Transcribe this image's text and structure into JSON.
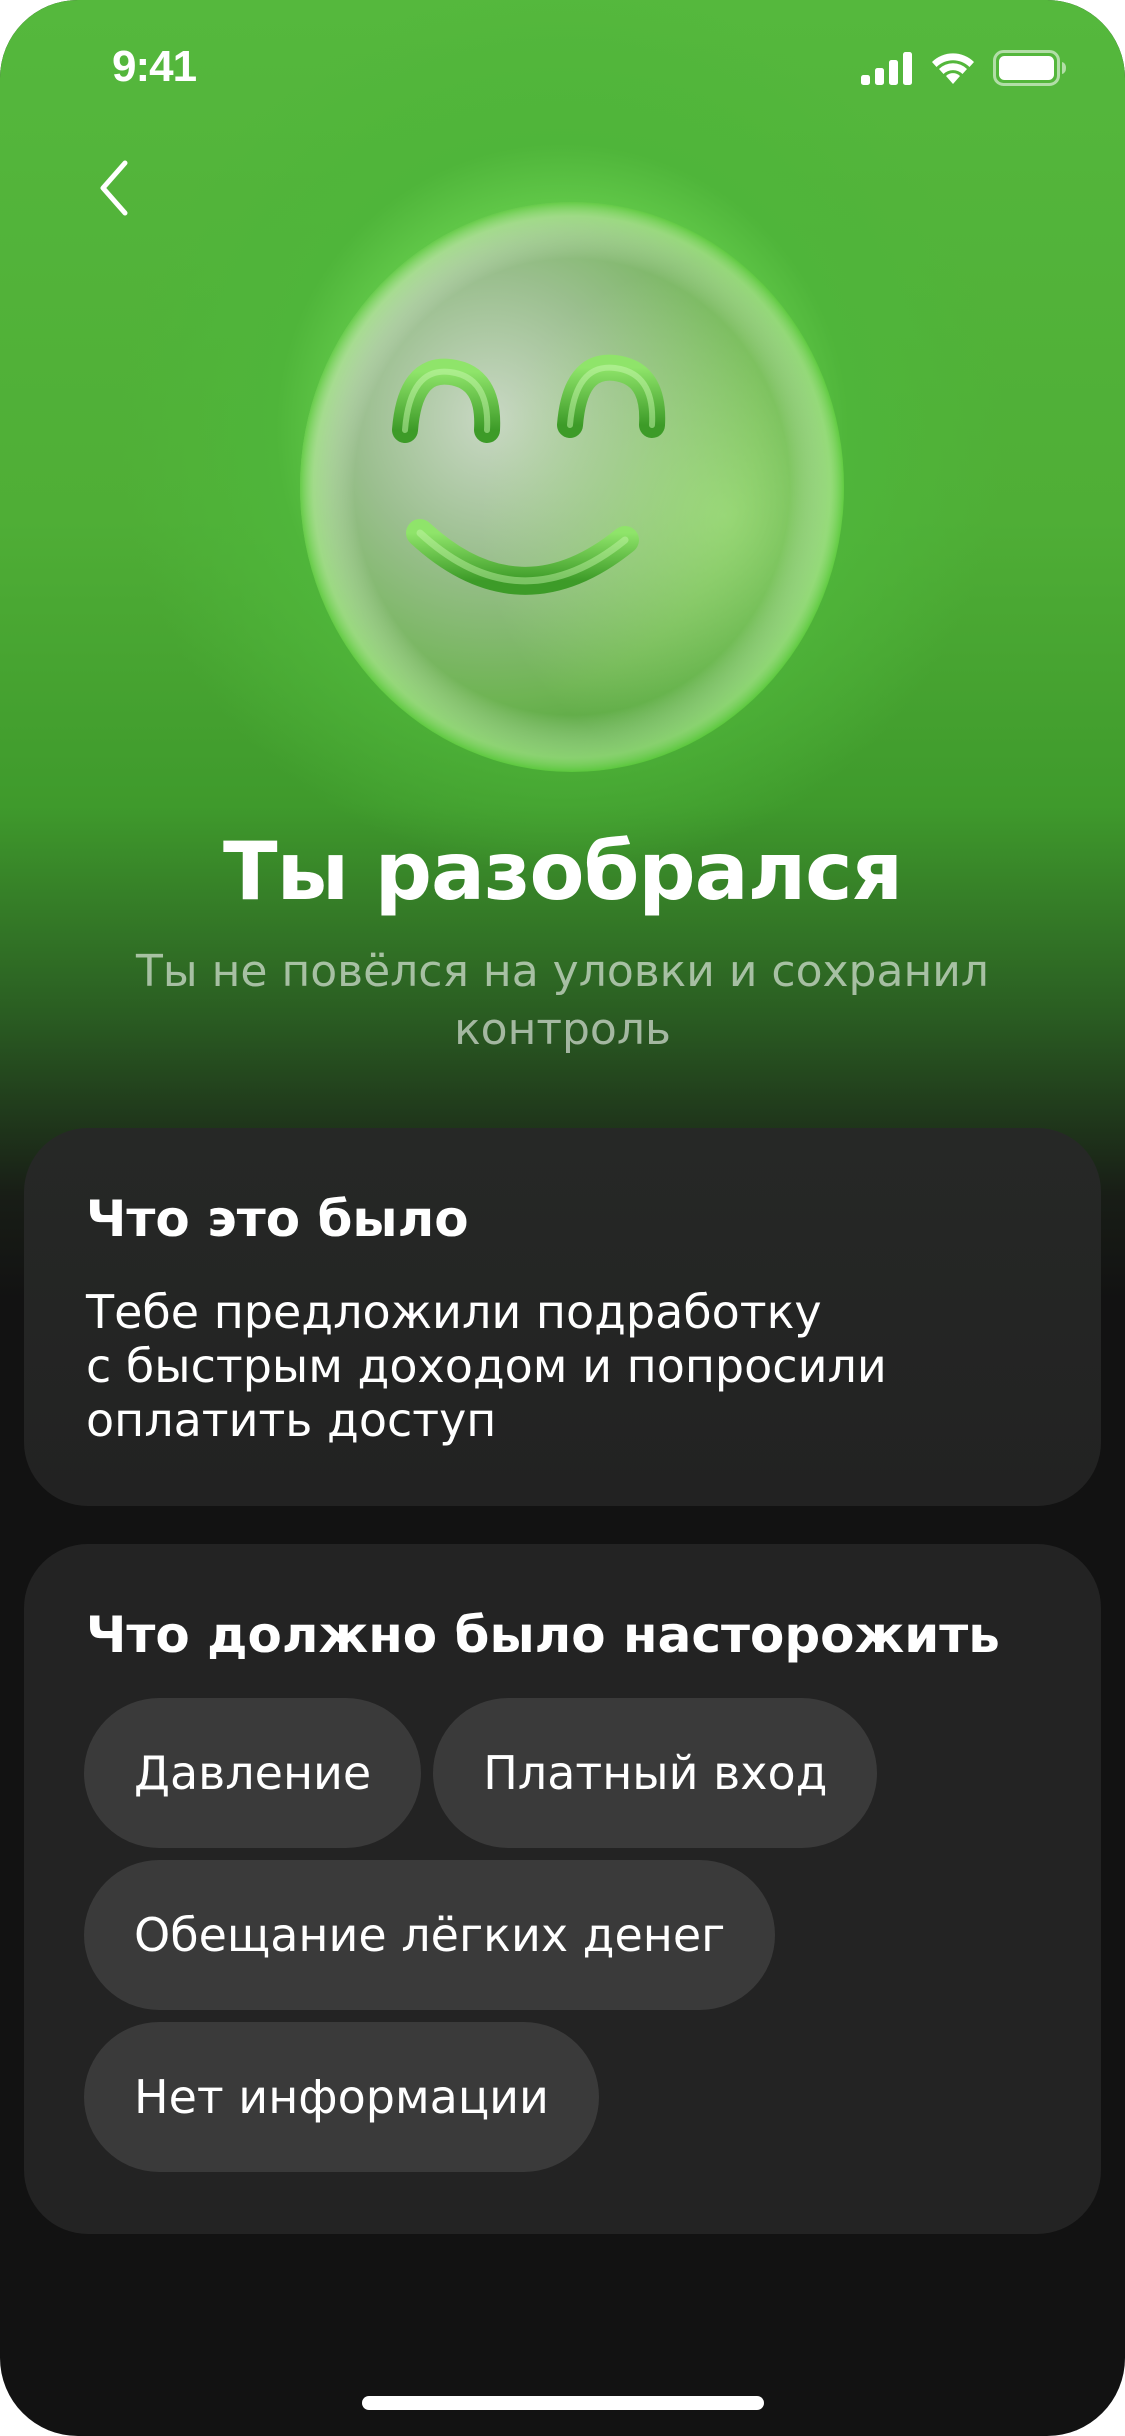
{
  "status_bar": {
    "time": "9:41",
    "icons": [
      "cellular-signal-icon",
      "wifi-icon",
      "battery-icon"
    ]
  },
  "nav": {
    "back_icon": "chevron-left-icon"
  },
  "hero": {
    "illustration": "smiley-face-icon",
    "title": "Ты разобрался",
    "subtitle": "Ты не повёлся на уловки и сохранил контроль"
  },
  "card_what": {
    "title": "Что это было",
    "lines": [
      "Тебе предложили подработку",
      "с быстрым доходом и попросили",
      "оплатить доступ"
    ]
  },
  "card_flags": {
    "title": "Что должно было насторожить",
    "tags": [
      "Давление",
      "Платный вход",
      "Обещание лёгких денег",
      "Нет информации"
    ]
  },
  "colors": {
    "accent_green": "#4fb53a",
    "card_background": "#232323",
    "tag_background": "#3a3a3a",
    "page_background": "#121212"
  }
}
